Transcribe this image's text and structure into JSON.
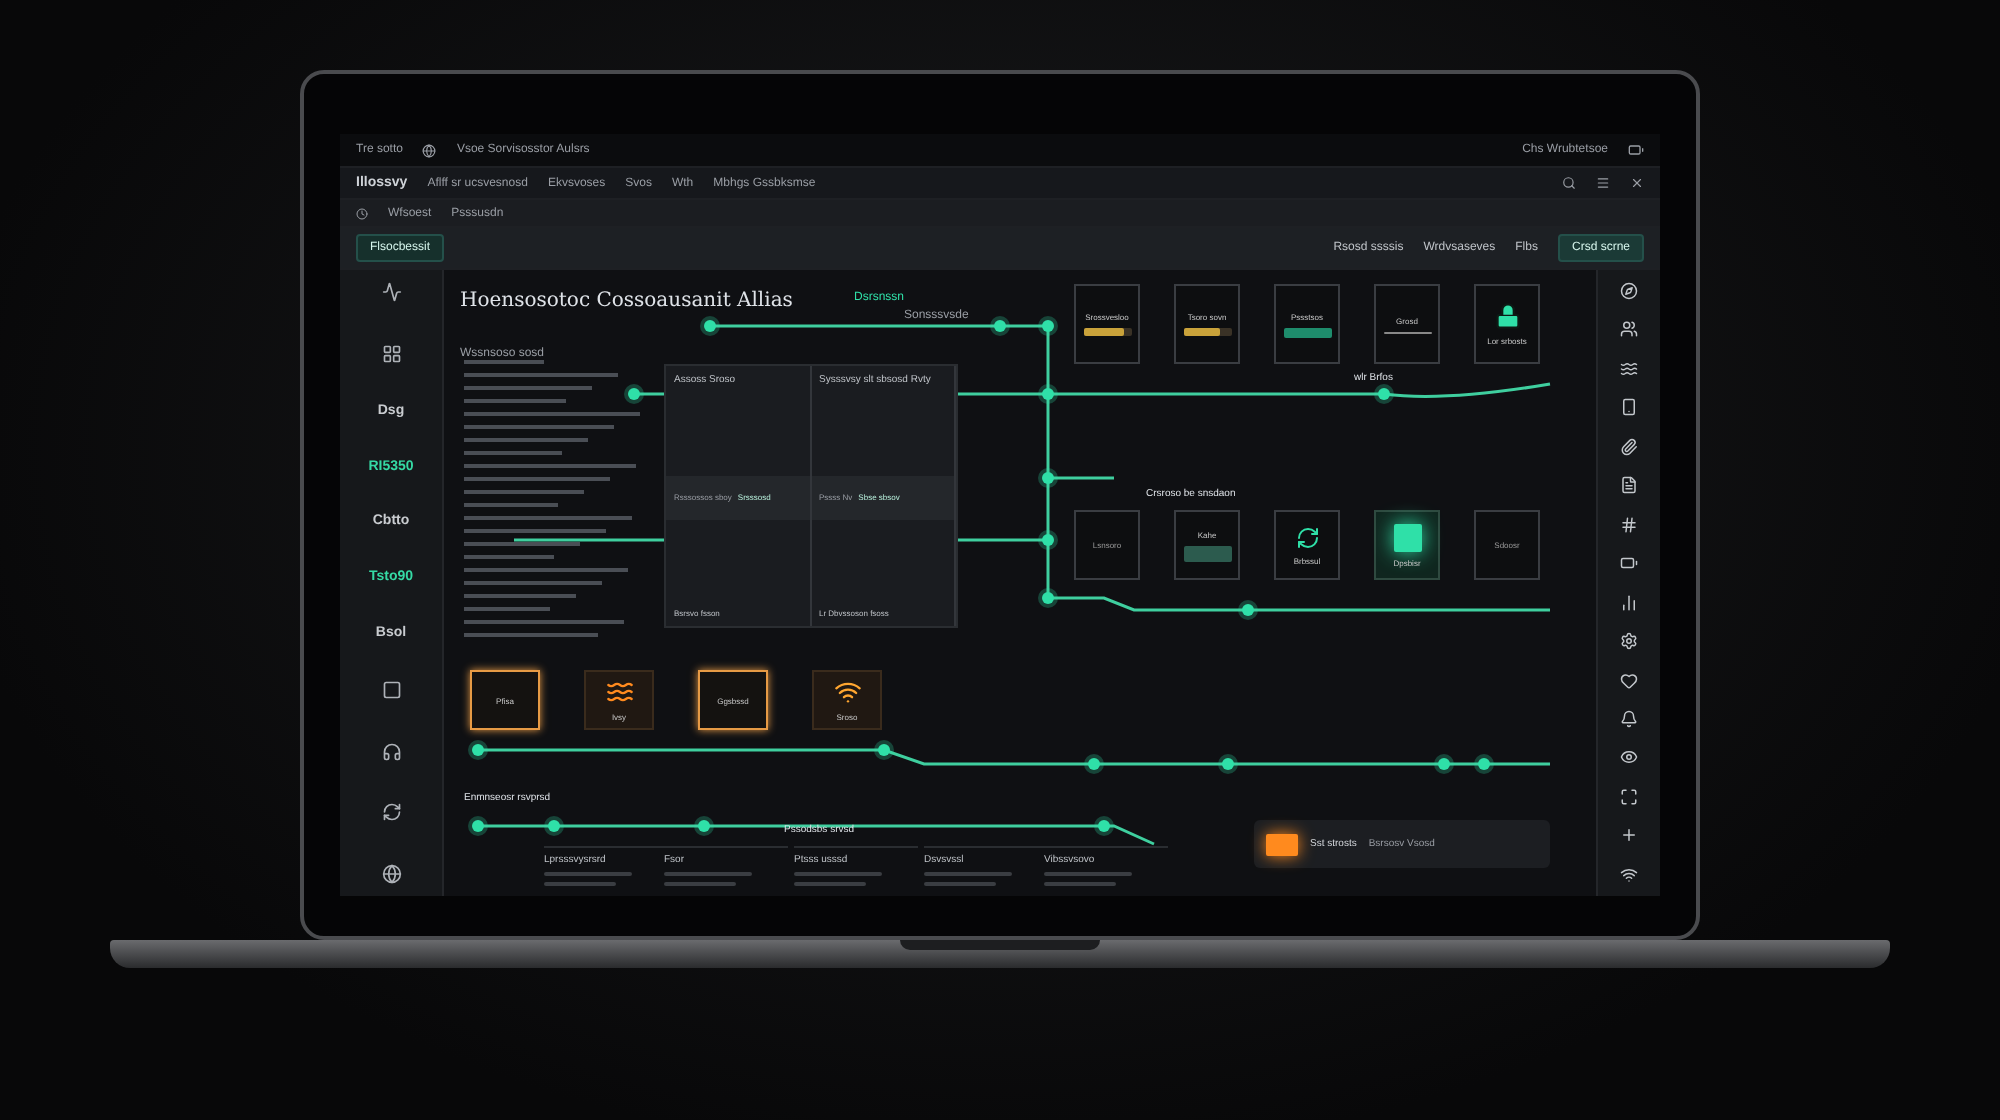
{
  "top_bar": {
    "left": "Tre sotto",
    "address": "Vsoe Sorvisosstor Aulsrs",
    "right": "Chs Wrubtetsoe"
  },
  "nav": {
    "brand": "Illossvy",
    "items": [
      "Aflff sr ucsvesnosd",
      "Ekvsvoses",
      "Svos",
      "Wth",
      "Mbhgs  Gssbksmse"
    ]
  },
  "sub_bar": {
    "items": [
      "Wfsoest",
      "Psssusdn"
    ]
  },
  "toolbar": {
    "left_button": "Flsocbessit",
    "actions": [
      "Rsosd ssssis",
      "Wrdvsaseves"
    ],
    "right_label": "Flbs",
    "right_button": "Crsd scrne"
  },
  "sidebar": [
    {
      "label": "Dsg",
      "color": "#c9ccd0"
    },
    {
      "label": "RI5350",
      "color": "#35d9a4"
    },
    {
      "label": "Cbtto",
      "color": "#c9ccd0"
    },
    {
      "label": "Tsto90",
      "color": "#35d9a4"
    },
    {
      "label": "Bsol",
      "color": "#c9ccd0"
    }
  ],
  "canvas": {
    "title": "Hoensosotoc Cossoausanit Allias",
    "subtitle": "Wssnsoso sosd",
    "legend": "Dsrsnssn",
    "legend_note": "Sonsssvsde",
    "panel": {
      "headings": [
        "Assoss Sroso",
        "Sysssvsy slt sbsosd Rvty"
      ],
      "row_labels": [
        "Rsssossos sboy",
        "Pssss Nv"
      ],
      "row_buttons": [
        "Srsssosd",
        "Sbse sbsov"
      ],
      "footers": [
        "Bsrsvo fsson",
        "Lr Dbvssoson fsoss"
      ]
    },
    "line_labels": [
      "wlr Brfos",
      "Crsroso be snsdaon",
      "Enmnseosr rsvprsd",
      "Pssodsbs srvsd"
    ],
    "card_rows": [
      {
        "cards": [
          {
            "kind": "bar",
            "label": "Srossvesloo",
            "level": 0.85
          },
          {
            "kind": "bar",
            "label": "Tsoro sovn",
            "level": 0.75
          },
          {
            "kind": "button",
            "label": "Pssstsos"
          },
          {
            "kind": "line",
            "label": "Grosd"
          },
          {
            "kind": "lock",
            "label": "Lor srbosts"
          }
        ]
      },
      {
        "cards": [
          {
            "kind": "empty",
            "label": "Lsnsoro"
          },
          {
            "kind": "table",
            "label": "Kahe"
          },
          {
            "kind": "spinner",
            "label": "Brbssul"
          },
          {
            "kind": "glow",
            "label": "Dpsbisr"
          },
          {
            "kind": "empty",
            "label": "Sdoosr"
          }
        ]
      },
      {
        "cards": [
          {
            "kind": "frame",
            "label": "Pfisa"
          },
          {
            "kind": "wave",
            "label": "Ivsy"
          },
          {
            "kind": "frame",
            "label": "Ggsbssd"
          },
          {
            "kind": "wifi",
            "label": "Sroso"
          }
        ]
      }
    ],
    "bottom": [
      "Lprsssvysrsrd",
      "Fsor",
      "Ptsss usssd",
      "Dsvsvssl",
      "Vibssvsovo"
    ],
    "alert": {
      "title": "Sst strosts",
      "note": "Bsrsosv Vsosd"
    }
  }
}
